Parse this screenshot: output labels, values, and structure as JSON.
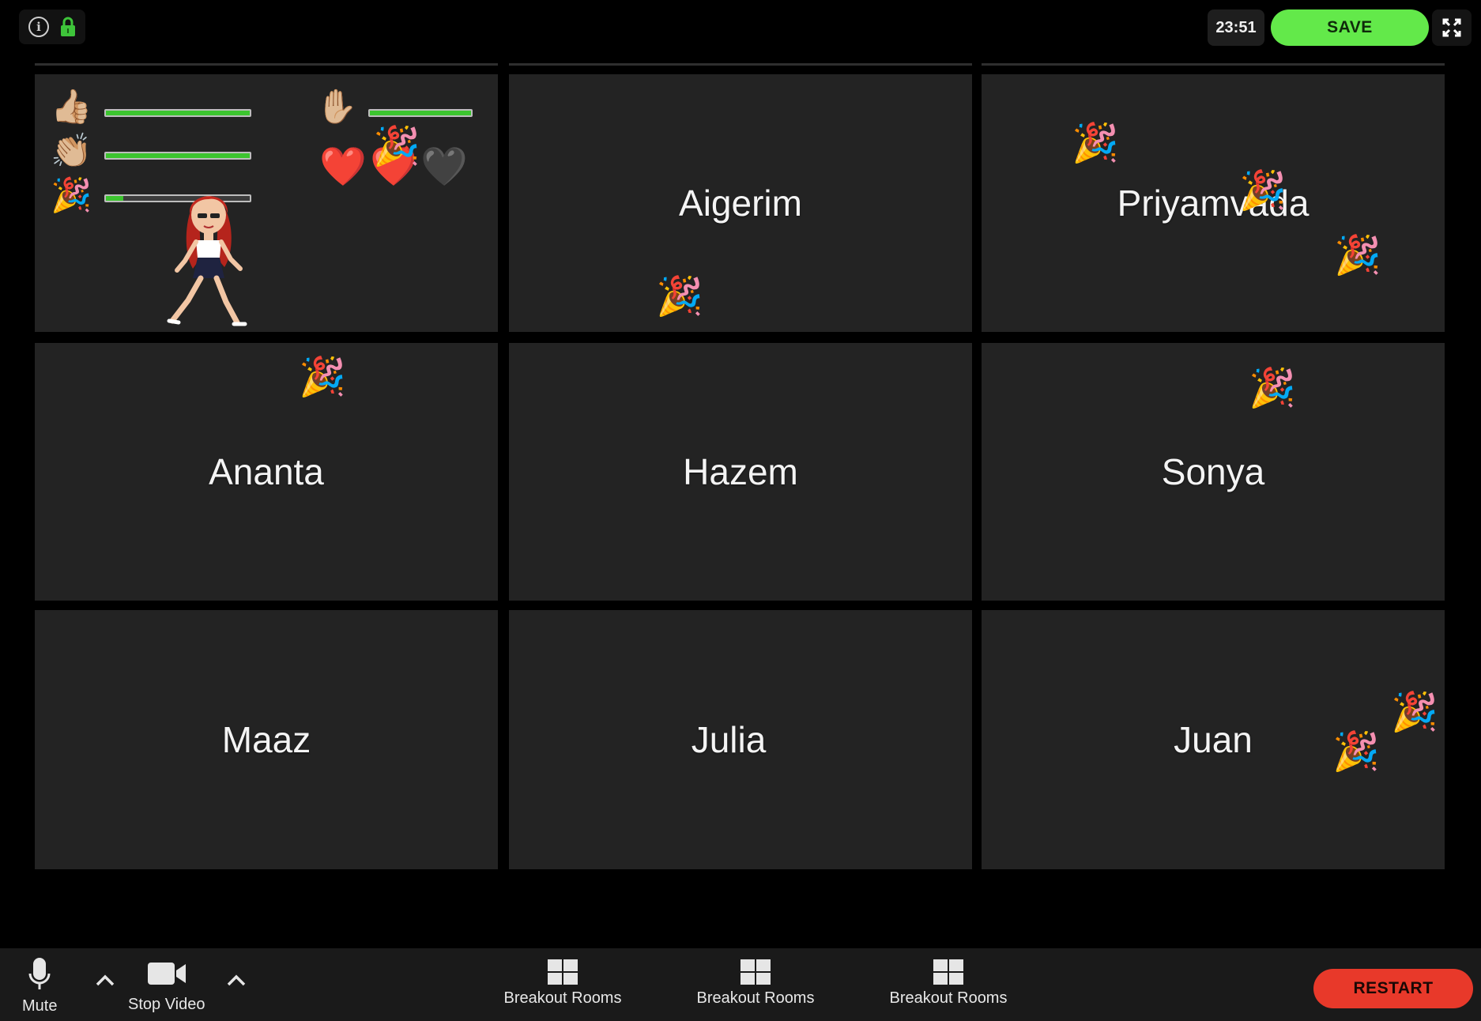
{
  "toolbar_top": {
    "info_icon": "info-icon",
    "lock_icon": "lock-icon",
    "lock_color": "#3ec43a",
    "timer": "23:51",
    "save_label": "SAVE",
    "save_color": "#63e94a",
    "fullscreen_icon": "fullscreen-icon"
  },
  "reactions_panel": {
    "meters": [
      {
        "icon": "thumbs-up-icon",
        "glyph": "👍🏼",
        "level": 1.0
      },
      {
        "icon": "clap-icon",
        "glyph": "👏🏼",
        "level": 1.0
      },
      {
        "icon": "party-popper-icon",
        "glyph": "🎉",
        "level": 0.12
      }
    ],
    "raise_hand": {
      "icon": "raised-hand-icon",
      "glyph": "✋🏼",
      "level": 1.0
    },
    "hearts": [
      {
        "icon": "red-heart-icon",
        "glyph": "❤️"
      },
      {
        "icon": "red-heart-icon",
        "glyph": "❤️"
      },
      {
        "icon": "black-heart-icon",
        "glyph": "🖤"
      }
    ]
  },
  "participants": [
    {
      "name": ""
    },
    {
      "name": "Aigerim"
    },
    {
      "name": "Priyamvada"
    },
    {
      "name": "Ananta"
    },
    {
      "name": "Hazem"
    },
    {
      "name": "Sonya"
    },
    {
      "name": "Maaz"
    },
    {
      "name": "Julia"
    },
    {
      "name": "Juan"
    }
  ],
  "party_popper_glyph": "🎉",
  "bottom_toolbar": {
    "mute_label": "Mute",
    "stop_video_label": "Stop Video",
    "breakout_rooms": [
      {
        "label": "Breakout Rooms"
      },
      {
        "label": "Breakout Rooms"
      },
      {
        "label": "Breakout Rooms"
      }
    ],
    "restart_label": "RESTART",
    "restart_color": "#e8392a"
  }
}
